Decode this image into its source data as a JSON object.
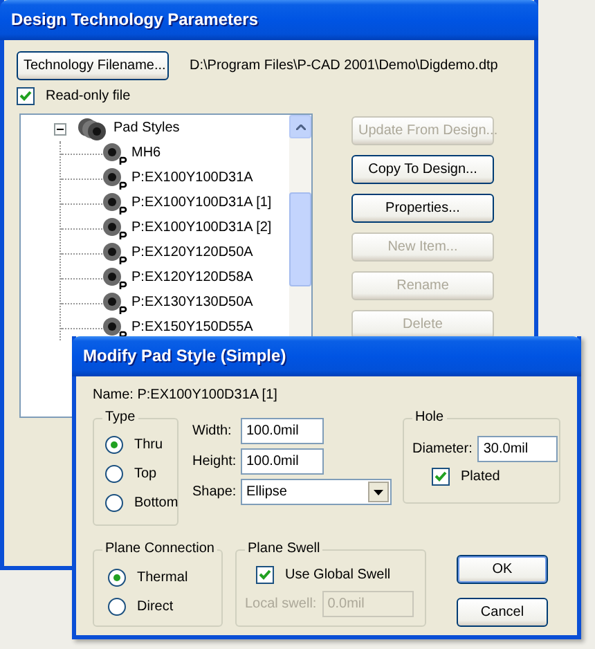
{
  "main_window": {
    "title": "Design Technology Parameters",
    "file_button": "Technology Filename...",
    "file_path": "D:\\Program Files\\P-CAD 2001\\Demo\\Digdemo.dtp",
    "read_only": {
      "label": "Read-only file",
      "checked": true
    },
    "tree": {
      "label": "Pad Styles",
      "expanded": true,
      "children": [
        {
          "label": "MH6"
        },
        {
          "label": "P:EX100Y100D31A"
        },
        {
          "label": "P:EX100Y100D31A [1]"
        },
        {
          "label": "P:EX100Y100D31A [2]"
        },
        {
          "label": "P:EX120Y120D50A"
        },
        {
          "label": "P:EX120Y120D58A"
        },
        {
          "label": "P:EX130Y130D50A"
        },
        {
          "label": "P:EX150Y150D55A"
        }
      ]
    },
    "buttons": [
      {
        "label": "Update From Design...",
        "disabled": true
      },
      {
        "label": "Copy To Design...",
        "disabled": false
      },
      {
        "label": "Properties...",
        "disabled": false
      },
      {
        "label": "New Item...",
        "disabled": true
      },
      {
        "label": "Rename",
        "disabled": true
      },
      {
        "label": "Delete",
        "disabled": true
      }
    ]
  },
  "dialog": {
    "title": "Modify Pad Style (Simple)",
    "name": "Name: P:EX100Y100D31A [1]",
    "type_group": {
      "title": "Type",
      "options": [
        {
          "label": "Thru",
          "selected": true
        },
        {
          "label": "Top",
          "selected": false
        },
        {
          "label": "Bottom",
          "selected": false
        }
      ]
    },
    "fields": [
      {
        "label": "Width:",
        "value": "100.0mil"
      },
      {
        "label": "Height:",
        "value": "100.0mil"
      }
    ],
    "shape": {
      "label": "Shape:",
      "value": "Ellipse"
    },
    "hole": {
      "title": "Hole",
      "diameter_label": "Diameter:",
      "diameter_value": "30.0mil",
      "plated": {
        "label": "Plated",
        "checked": true
      }
    },
    "plane_connection": {
      "title": "Plane Connection",
      "options": [
        {
          "label": "Thermal",
          "selected": true
        },
        {
          "label": "Direct",
          "selected": false
        }
      ]
    },
    "plane_swell": {
      "title": "Plane Swell",
      "global": {
        "label": "Use Global Swell",
        "checked": true
      },
      "local": {
        "label": "Local swell:",
        "value": "0.0mil",
        "disabled": true
      }
    },
    "buttons": [
      {
        "label": "OK",
        "default": true
      },
      {
        "label": "Cancel",
        "default": false
      }
    ]
  }
}
